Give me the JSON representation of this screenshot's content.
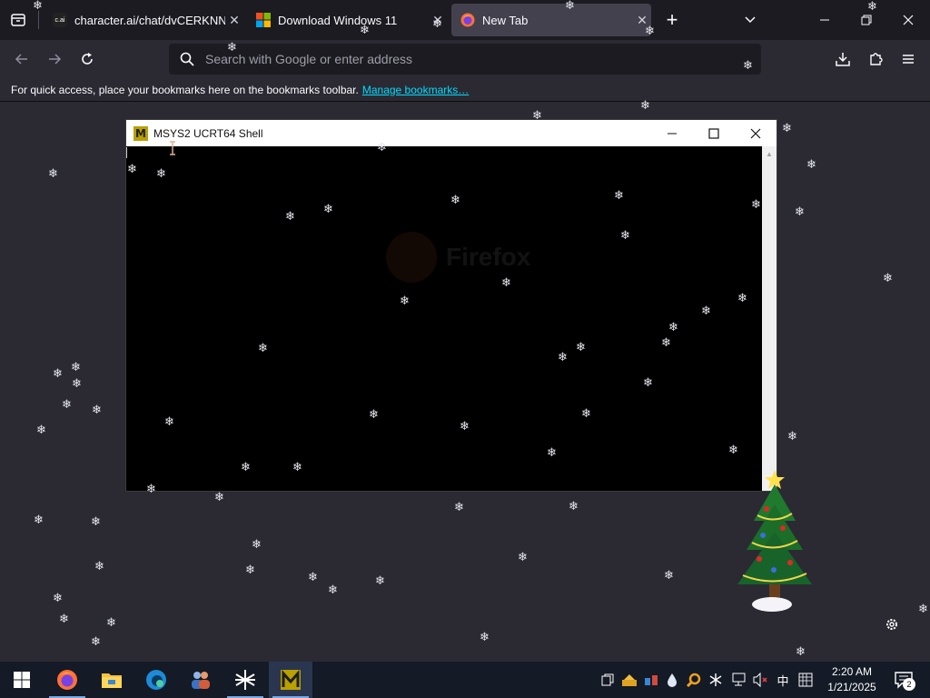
{
  "browser": {
    "tabs": [
      {
        "label": "character.ai/chat/dvCERKNNTa",
        "favicon_text": "c.ai",
        "close": "✕",
        "active": false
      },
      {
        "label": "Download Windows 11",
        "close": "✕",
        "active": false
      },
      {
        "label": "New Tab",
        "close": "✕",
        "active": true
      }
    ],
    "new_tab_label": "+",
    "urlbar_placeholder": "Search with Google or enter address",
    "bookmarks_text": "For quick access, place your bookmarks here on the bookmarks toolbar.",
    "bookmarks_link": "Manage bookmarks…",
    "watermark_text": "Firefox"
  },
  "terminal": {
    "title": "MSYS2 UCRT64 Shell",
    "app_icon_letter": "M"
  },
  "taskbar": {
    "clock_time": "2:20 AM",
    "clock_date": "1/21/2025",
    "ime_label": "中",
    "notification_count": "2",
    "apps": [
      "firefox-icon",
      "file-explorer-icon",
      "edge-icon",
      "people-icon",
      "snowflake-app-icon",
      "msys2-icon"
    ]
  },
  "colors": {
    "tab_strip": "#1c1b22",
    "toolbar": "#2b2a33",
    "link": "#00ddff",
    "taskbar": "#141a26",
    "msys_icon": "#b8a100"
  }
}
